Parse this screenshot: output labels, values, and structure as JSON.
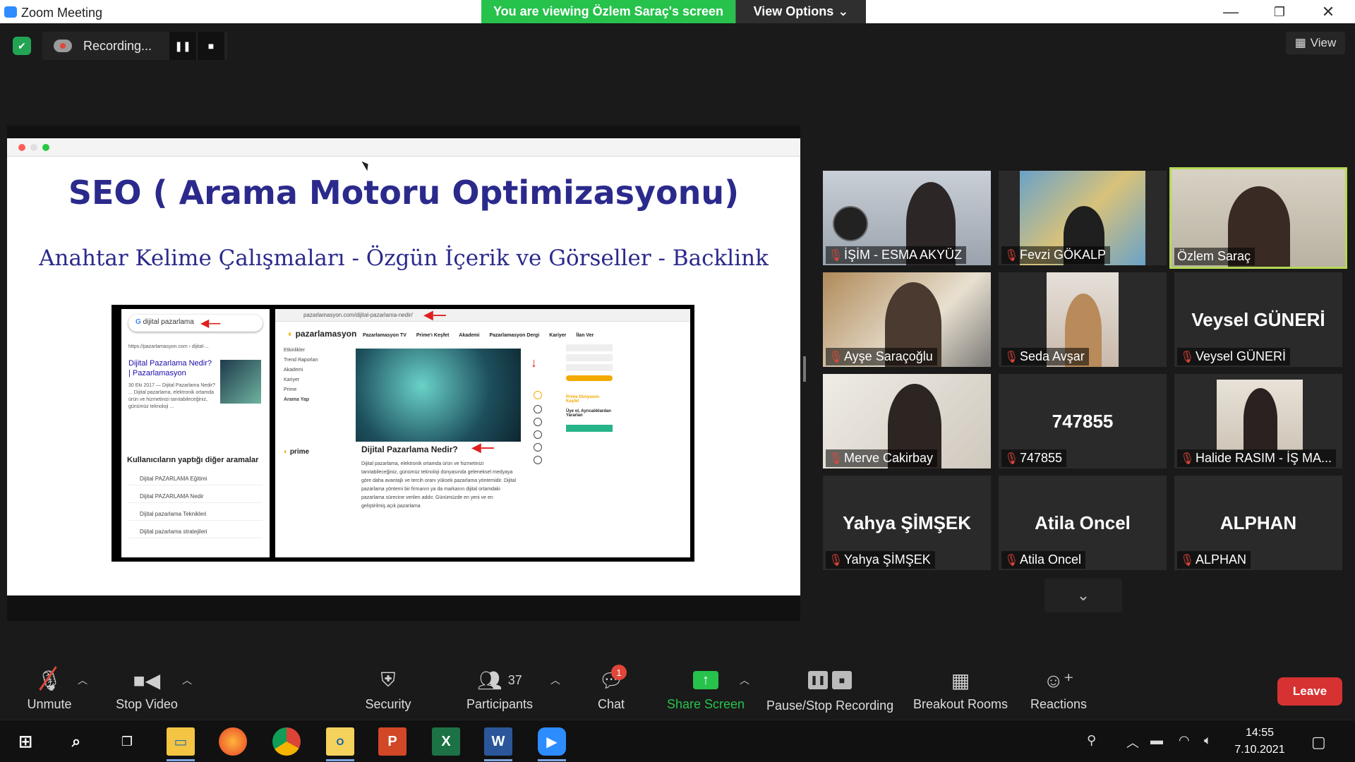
{
  "window": {
    "title": "Zoom Meeting",
    "banner": "You are viewing Özlem Saraç's screen",
    "view_options": "View Options"
  },
  "topbar": {
    "recording_label": "Recording...",
    "view_label": "View"
  },
  "slide": {
    "title": "SEO ( Arama Motoru Optimizasyonu)",
    "subtitle": "Anahtar Kelime Çalışmaları - Özgün İçerik ve Görseller - Backlink",
    "google": {
      "query": "dijital pazarlama",
      "result_url": "https://pazarlamasyon.com › dijital-...",
      "result_title": "Dijital Pazarlama Nedir? | Pazarlamasyon",
      "result_snippet": "30 Eki 2017 — Dijital Pazarlama Nedir? ... Dijital pazarlama, elektronik ortamda ürün ve hizmetinizi tanıtabileceğiniz, günümüz teknoloji ...",
      "others_heading": "Kullanıcıların yaptığı diğer aramalar",
      "others": [
        "Dijital PAZARLAMA Eğitimi",
        "Dijital PAZARLAMA Nedir",
        "Dijital pazarlama Teknikleri",
        "Dijital pazarlama stratejileri"
      ]
    },
    "site": {
      "url": "pazarlamasyon.com/dijital-pazarlama-nedir/",
      "logo": "pazarlamasyon",
      "nav": [
        "Pazarlamasyon TV",
        "Prime'ı Keşfet",
        "Akademi",
        "Pazarlamasyon Dergi",
        "Kariyer",
        "İlan Ver"
      ],
      "side": [
        "Etkinlikler",
        "Trend Raporları",
        "Akademi",
        "Kariyer",
        "Prime",
        "Arama Yap"
      ],
      "prime": "prime",
      "heading": "Dijital Pazarlama Nedir?",
      "body": "Dijital pazarlama, elektronik ortamda ürün ve hizmetinizi tanıtabileceğiniz, günümüz teknoloji dünyasında geleneksel medyaya göre daha avantajlı ve tercih oranı yüksek pazarlama yöntemidir. Dijital pazarlama yöntemi bir firmanın ya da markanın dijital ortamdaki pazarlama sürecine verilen addır. Günümüzde en yeni ve en geliştirilmiş açık pazarlama",
      "right_promo": "Prime Dünyasını Keşfet",
      "right_sub": "Üye ol, Ayrıcalıklardan Yararlan"
    }
  },
  "participants_tiles": [
    {
      "name": "İŞİM - ESMA AKYÜZ",
      "kind": "video"
    },
    {
      "name": "Fevzi GÖKALP",
      "kind": "video"
    },
    {
      "name": "Özlem Saraç",
      "kind": "video",
      "active": true
    },
    {
      "name": "Ayşe Saraçoğlu",
      "kind": "video"
    },
    {
      "name": "Seda Avşar",
      "kind": "video"
    },
    {
      "name": "Veysel GÜNERİ",
      "kind": "name",
      "big": "Veysel GÜNERİ"
    },
    {
      "name": "Merve Cakirbay",
      "kind": "video"
    },
    {
      "name": "747855",
      "kind": "name",
      "big": "747855"
    },
    {
      "name": "Halide RASIM - İŞ MA...",
      "kind": "video"
    },
    {
      "name": "Yahya ŞİMŞEK",
      "kind": "name",
      "big": "Yahya ŞİMŞEK"
    },
    {
      "name": "Atila Oncel",
      "kind": "name",
      "big": "Atila Oncel"
    },
    {
      "name": "ALPHAN",
      "kind": "name",
      "big": "ALPHAN"
    }
  ],
  "toolbar": {
    "unmute": "Unmute",
    "stop_video": "Stop Video",
    "security": "Security",
    "participants": "Participants",
    "participants_count": "37",
    "chat": "Chat",
    "chat_badge": "1",
    "share_screen": "Share Screen",
    "pause_stop_recording": "Pause/Stop Recording",
    "breakout_rooms": "Breakout Rooms",
    "reactions": "Reactions",
    "leave": "Leave"
  },
  "taskbar": {
    "time": "14:55",
    "date": "7.10.2021"
  },
  "colors": {
    "share_green": "#27c24c",
    "leave_red": "#d73232",
    "active_speaker": "#b5d957",
    "slide_blue": "#2b2a8c"
  }
}
